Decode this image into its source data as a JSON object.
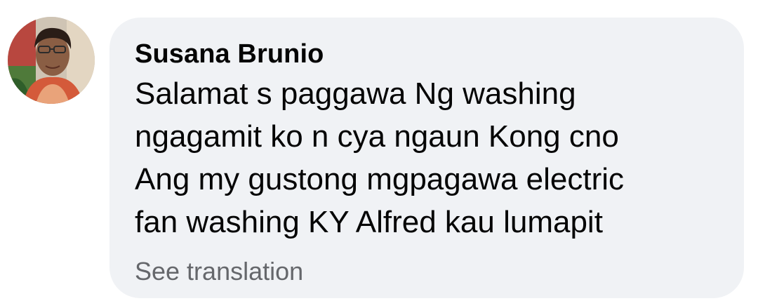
{
  "comment": {
    "avatar_icon": "user-avatar-photo",
    "author": "Susana Brunio",
    "text_lines": [
      "Salamat s paggawa Ng washing",
      "ngagamit ko n cya ngaun Kong cno",
      "Ang my gustong mgpagawa electric",
      "fan washing KY Alfred kau lumapit"
    ],
    "see_translation": "See translation"
  },
  "colors": {
    "bubble_background": "#f0f2f5",
    "text": "#050505",
    "secondary_text": "#65676b"
  }
}
